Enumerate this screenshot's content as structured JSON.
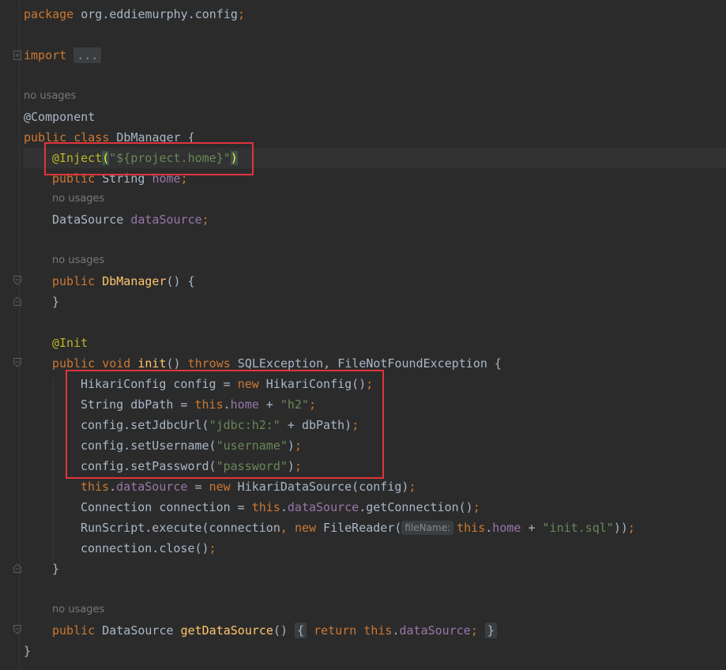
{
  "code": {
    "package_line": {
      "kw": "package",
      "name": " org.eddiemurphy.config",
      "semi": ";"
    },
    "import_line": {
      "kw": "import",
      "folded": "..."
    },
    "hint_usages_1": "no usages",
    "component_annotation": "@Component",
    "class_line": {
      "kw1": "public",
      "kw2": "class",
      "name": "DbManager",
      "brace": " {"
    },
    "inject_line": {
      "annotation": "@Inject",
      "open": "(",
      "value": "\"${project.home}\"",
      "close": ")"
    },
    "home_field_line": {
      "kw": "public",
      "type": " String ",
      "name": "home",
      "semi": ";"
    },
    "hint_usages_2": "no usages",
    "datasource_field_line": {
      "type": "DataSource ",
      "name": "dataSource",
      "semi": ";"
    },
    "hint_usages_3": "no usages",
    "ctor_line": {
      "kw": "public",
      "name": "DbManager",
      "rest": "() {"
    },
    "ctor_close": "}",
    "init_annotation": "@Init",
    "init_sig": {
      "kw1": "public",
      "kw2": "void",
      "name": "init",
      "paren": "() ",
      "kw3": "throws",
      "rest": " SQLException, FileNotFoundException {"
    },
    "body1": {
      "a": "HikariConfig config = ",
      "kw": "new",
      "b": " HikariConfig()",
      "semi": ";"
    },
    "body2": {
      "a": "String dbPath = ",
      "kw": "this",
      "dot": ".",
      "fld": "home",
      "b": " + ",
      "str": "\"h2\"",
      "semi": ";"
    },
    "body3": {
      "a": "config.setJdbcUrl(",
      "str": "\"jdbc:h2:\"",
      "b": " + dbPath)",
      "semi": ";"
    },
    "body4": {
      "a": "config.setUsername(",
      "str": "\"username\"",
      "b": ")",
      "semi": ";"
    },
    "body5": {
      "a": "config.setPassword(",
      "str": "\"password\"",
      "b": ")",
      "semi": ";"
    },
    "body6": {
      "kw": "this",
      "dot": ".",
      "fld": "dataSource",
      "a": " = ",
      "kw2": "new",
      "b": " HikariDataSource(config)",
      "semi": ";"
    },
    "body7": {
      "a": "Connection connection = ",
      "kw": "this",
      "dot": ".",
      "fld": "dataSource",
      "b": ".getConnection()",
      "semi": ";"
    },
    "body8": {
      "a": "RunScript.execute(connection",
      "comma": ", ",
      "kw": "new",
      "b": " FileReader(",
      "hint": "fileName:",
      "kw2": "this",
      "dot": ".",
      "fld": "home",
      "c": " + ",
      "str": "\"init.sql\"",
      "d": "))",
      "semi": ";"
    },
    "body9": {
      "a": "connection.close()",
      "semi": ";"
    },
    "init_close": "}",
    "hint_usages_4": "no usages",
    "getter_line": {
      "kw": "public",
      "type": " DataSource ",
      "name": "getDataSource",
      "paren": "() ",
      "open": "{",
      "kw2": "return",
      "kw3": "this",
      "dot": ".",
      "fld": "dataSource",
      "semi": ";",
      "close": "}"
    },
    "class_close": "}"
  },
  "colors": {
    "background": "#2b2b2b",
    "keyword": "#cc7832",
    "annotation": "#bbb529",
    "string": "#6a8759",
    "field": "#9876aa",
    "method": "#ffc66d",
    "text": "#a9b7c6",
    "highlight_box": "#e0343c"
  }
}
